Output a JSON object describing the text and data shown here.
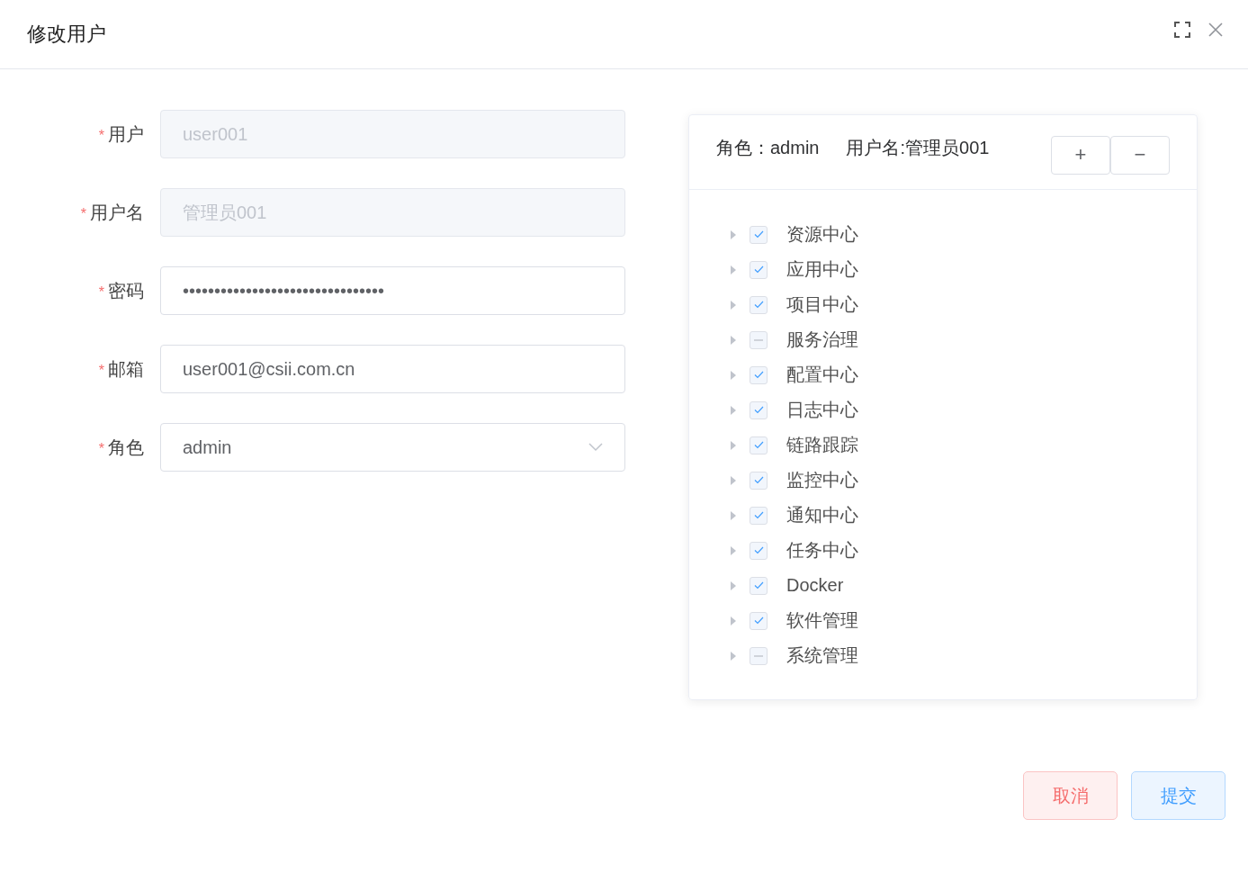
{
  "dialog": {
    "title": "修改用户"
  },
  "form": {
    "fields": [
      {
        "label": "用户",
        "marker": "*",
        "value": "user001",
        "disabled": true,
        "kind": "text"
      },
      {
        "label": "用户名",
        "marker": "*",
        "value": "管理员001",
        "disabled": true,
        "kind": "text"
      },
      {
        "label": "密码",
        "marker": "*",
        "value": "••••••••••••••••••••••••••••••••",
        "disabled": false,
        "kind": "text"
      },
      {
        "label": "邮箱",
        "marker": "*",
        "value": "user001@csii.com.cn",
        "disabled": false,
        "kind": "text"
      },
      {
        "label": "角色",
        "marker": "*",
        "value": "admin",
        "disabled": false,
        "kind": "select"
      }
    ]
  },
  "permissions": {
    "role_text": "角色：admin",
    "username_text": "用户名:管理员001",
    "expand_button": "+",
    "collapse_button": "−",
    "tree": [
      {
        "label": "资源中心",
        "checked": true
      },
      {
        "label": "应用中心",
        "checked": true
      },
      {
        "label": "项目中心",
        "checked": true
      },
      {
        "label": "服务治理",
        "checked": false,
        "indeterminate": true
      },
      {
        "label": "配置中心",
        "checked": true
      },
      {
        "label": "日志中心",
        "checked": true
      },
      {
        "label": "链路跟踪",
        "checked": true
      },
      {
        "label": "监控中心",
        "checked": true
      },
      {
        "label": "通知中心",
        "checked": true
      },
      {
        "label": "任务中心",
        "checked": true
      },
      {
        "label": "Docker",
        "checked": true
      },
      {
        "label": "软件管理",
        "checked": true
      },
      {
        "label": "系统管理",
        "checked": false,
        "indeterminate": true
      }
    ]
  },
  "buttons": [
    {
      "label": "取消",
      "kind": "danger"
    },
    {
      "label": "提交",
      "kind": "primary"
    }
  ]
}
